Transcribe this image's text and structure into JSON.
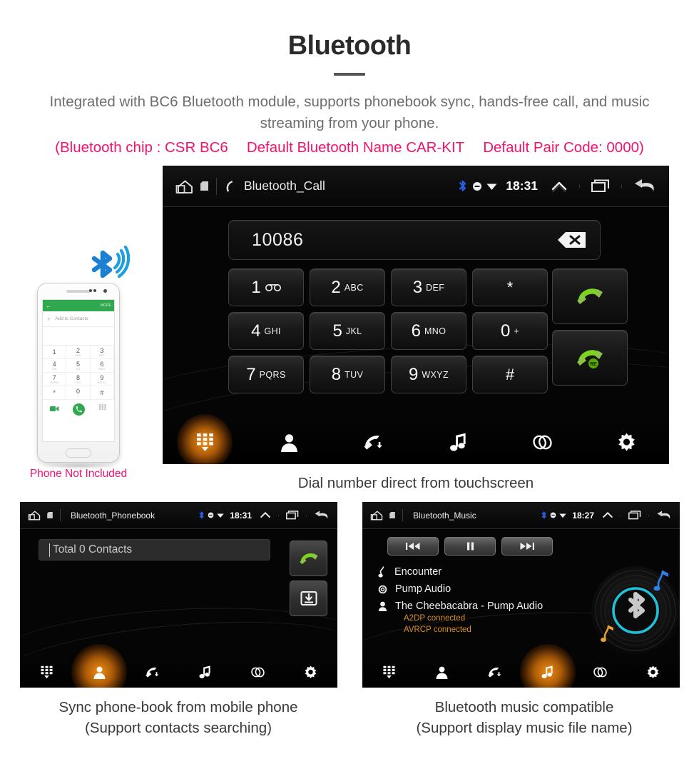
{
  "header": {
    "title": "Bluetooth",
    "subtitle": "Integrated with BC6 Bluetooth module, supports phonebook sync, hands-free call, and music streaming from your phone.",
    "specs": [
      "(Bluetooth chip : CSR BC6",
      "Default Bluetooth Name CAR-KIT",
      "Default Pair Code: 0000)"
    ],
    "accent_color": "#f2126f",
    "text_color": "#6e6e6e"
  },
  "dialer": {
    "statusbar": {
      "home_icon": "home-icon",
      "sd_icon": "sdcard-icon",
      "call_icon": "phone-handset-icon",
      "title": "Bluetooth_Call",
      "bluetooth_icon": "bluetooth-icon",
      "mute_icon": "mute-icon",
      "wifi_icon": "wifi-icon",
      "time": "18:31",
      "expand_icon": "chevron-up-icon",
      "recents_icon": "recents-icon",
      "back_icon": "back-arrow-icon"
    },
    "input_value": "10086",
    "backspace_icon": "backspace-icon",
    "keys": [
      {
        "digit": "1",
        "letters": "∞",
        "special": "voicemail"
      },
      {
        "digit": "2",
        "letters": "ABC"
      },
      {
        "digit": "3",
        "letters": "DEF"
      },
      {
        "digit": "*",
        "letters": ""
      },
      {
        "digit": "4",
        "letters": "GHI"
      },
      {
        "digit": "5",
        "letters": "JKL"
      },
      {
        "digit": "6",
        "letters": "MNO"
      },
      {
        "digit": "0",
        "letters": "+"
      },
      {
        "digit": "7",
        "letters": "PQRS"
      },
      {
        "digit": "8",
        "letters": "TUV"
      },
      {
        "digit": "9",
        "letters": "WXYZ"
      },
      {
        "digit": "#",
        "letters": ""
      }
    ],
    "call_button": "call-icon",
    "redial_button": "redial-icon",
    "redial_badge": "RE",
    "nav": [
      {
        "name": "dialpad",
        "icon": "dialpad-icon",
        "active": true
      },
      {
        "name": "contacts",
        "icon": "contacts-icon",
        "active": false
      },
      {
        "name": "call-log",
        "icon": "call-log-icon",
        "active": false
      },
      {
        "name": "music",
        "icon": "music-note-icon",
        "active": false
      },
      {
        "name": "link",
        "icon": "link-icon",
        "active": false
      },
      {
        "name": "settings",
        "icon": "gear-icon",
        "active": false
      }
    ],
    "caption": "Dial number direct from touchscreen"
  },
  "phonebook": {
    "statusbar": {
      "title": "Bluetooth_Phonebook",
      "time": "18:31"
    },
    "search_text": "Total 0 Contacts",
    "call_button": "call-icon",
    "download_button": "download-contacts-icon",
    "nav": [
      {
        "name": "dialpad",
        "icon": "dialpad-icon",
        "active": false
      },
      {
        "name": "contacts",
        "icon": "contacts-icon",
        "active": true
      },
      {
        "name": "call-log",
        "icon": "call-log-icon",
        "active": false
      },
      {
        "name": "music",
        "icon": "music-note-icon",
        "active": false
      },
      {
        "name": "link",
        "icon": "link-icon",
        "active": false
      },
      {
        "name": "settings",
        "icon": "gear-icon",
        "active": false
      }
    ],
    "caption_line1": "Sync phone-book from mobile phone",
    "caption_line2": "(Support contacts searching)"
  },
  "music": {
    "statusbar": {
      "title": "Bluetooth_Music",
      "time": "18:27"
    },
    "transport": [
      {
        "name": "previous",
        "icon": "skip-previous-icon"
      },
      {
        "name": "pause",
        "icon": "pause-icon"
      },
      {
        "name": "next",
        "icon": "skip-next-icon"
      }
    ],
    "track_title": "Encounter",
    "album": "Pump Audio",
    "artist": "The Cheebacabra - Pump Audio",
    "profiles": [
      "A2DP connected",
      "AVRCP connected"
    ],
    "profile_color": "#d98f22",
    "album_art": "vinyl-bluetooth-icon",
    "nav": [
      {
        "name": "dialpad",
        "icon": "dialpad-icon",
        "active": false
      },
      {
        "name": "contacts",
        "icon": "contacts-icon",
        "active": false
      },
      {
        "name": "call-log",
        "icon": "call-log-icon",
        "active": false
      },
      {
        "name": "music",
        "icon": "music-note-icon",
        "active": true
      },
      {
        "name": "link",
        "icon": "link-icon",
        "active": false
      },
      {
        "name": "settings",
        "icon": "gear-icon",
        "active": false
      }
    ],
    "caption_line1": "Bluetooth music compatible",
    "caption_line2": "(Support display music file name)"
  },
  "phone_mock": {
    "appbar_back": "←",
    "appbar_more": "MORE",
    "add_to_contacts": "Add to Contacts",
    "keys": [
      {
        "d": "1",
        "s": ""
      },
      {
        "d": "2",
        "s": "ABC"
      },
      {
        "d": "3",
        "s": "DEF"
      },
      {
        "d": "4",
        "s": "GHI"
      },
      {
        "d": "5",
        "s": "JKL"
      },
      {
        "d": "6",
        "s": "MNO"
      },
      {
        "d": "7",
        "s": "PQRS"
      },
      {
        "d": "8",
        "s": "TUV"
      },
      {
        "d": "9",
        "s": "WXYZ"
      },
      {
        "d": "*",
        "s": ""
      },
      {
        "d": "0",
        "s": "+"
      },
      {
        "d": "#",
        "s": ""
      }
    ],
    "note": "Phone Not Included",
    "note_color": "#f2126f",
    "bluetooth_signal_icon": "bluetooth-signal-icon"
  }
}
